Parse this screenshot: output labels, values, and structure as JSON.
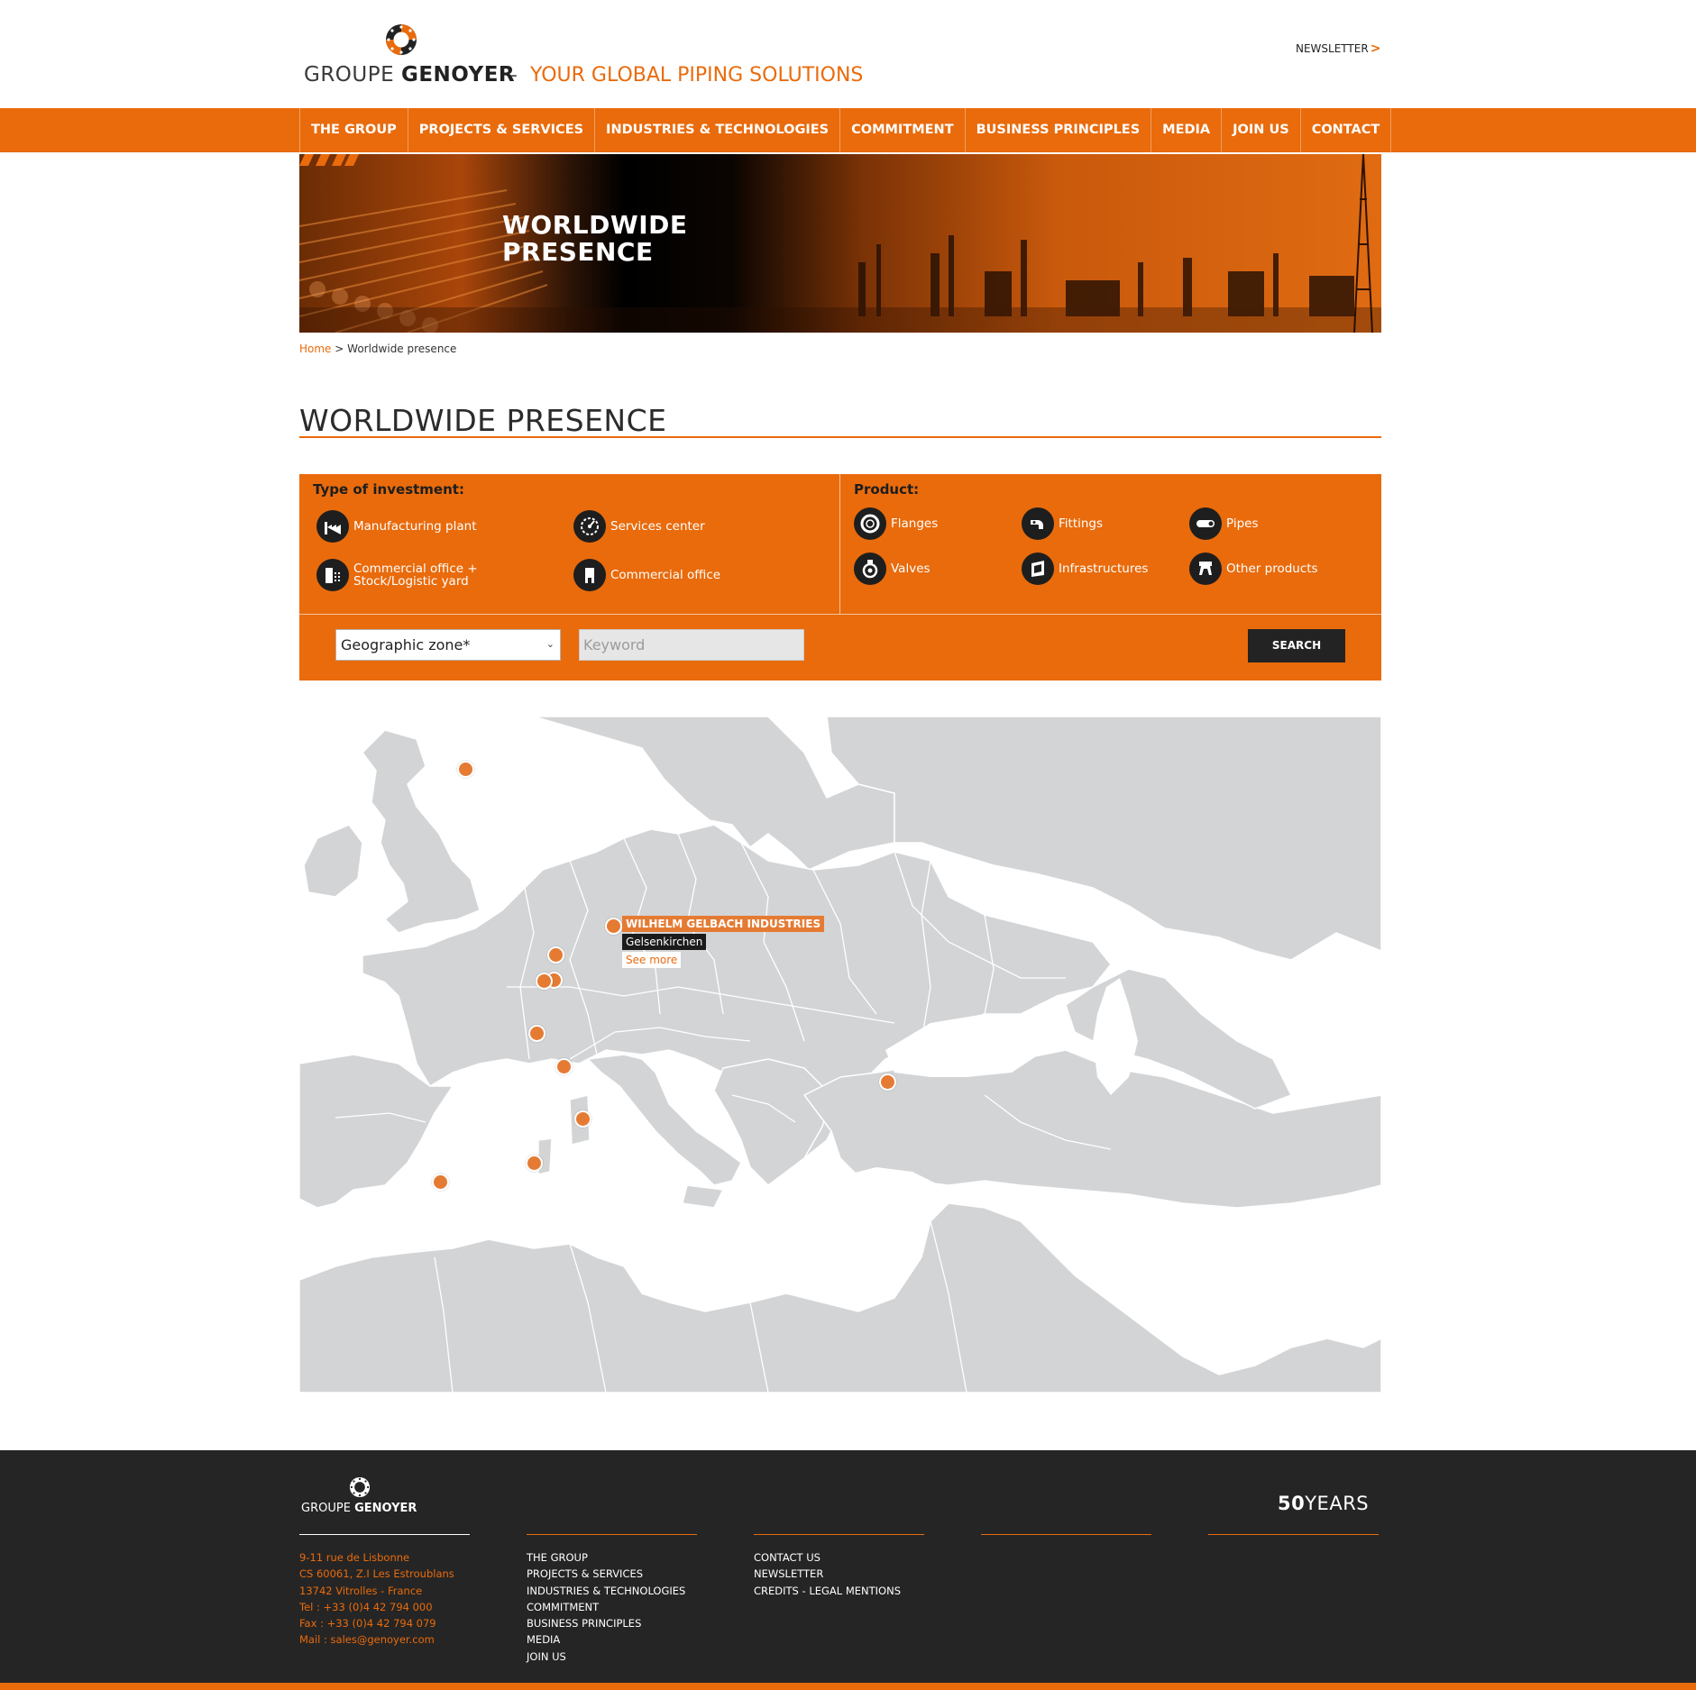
{
  "header": {
    "logo_prefix": "GROUPE",
    "logo_bold": "GENOYER",
    "separator": "-",
    "tagline": "YOUR GLOBAL PIPING SOLUTIONS",
    "newsletter": "NEWSLETTER",
    "newsletter_chevron": ">"
  },
  "nav": {
    "items": [
      {
        "label": "THE GROUP"
      },
      {
        "label": "PROJECTS & SERVICES"
      },
      {
        "label": "INDUSTRIES & TECHNOLOGIES"
      },
      {
        "label": "COMMITMENT"
      },
      {
        "label": "BUSINESS PRINCIPLES"
      },
      {
        "label": "MEDIA"
      },
      {
        "label": "JOIN US"
      },
      {
        "label": "CONTACT"
      }
    ]
  },
  "banner": {
    "title_line1": "WORLDWIDE",
    "title_line2": "PRESENCE"
  },
  "breadcrumb": {
    "home": "Home",
    "separator": ">",
    "current": "Worldwide presence"
  },
  "page_title": "WORLDWIDE PRESENCE",
  "filters": {
    "investment_heading": "Type of investment:",
    "investment_types": [
      {
        "label": "Manufacturing plant",
        "icon": "factory-icon"
      },
      {
        "label": "Services center",
        "icon": "gauge-icon"
      },
      {
        "label": "Commercial office + Stock/Logistic yard",
        "icon": "warehouse-icon"
      },
      {
        "label": "Commercial office",
        "icon": "office-icon"
      }
    ],
    "product_heading": "Product:",
    "products": [
      {
        "label": "Flanges",
        "icon": "flange-icon"
      },
      {
        "label": "Fittings",
        "icon": "fitting-icon"
      },
      {
        "label": "Pipes",
        "icon": "pipe-icon"
      },
      {
        "label": "Valves",
        "icon": "valve-icon"
      },
      {
        "label": "Infrastructures",
        "icon": "infrastructure-icon"
      },
      {
        "label": "Other products",
        "icon": "other-products-icon"
      }
    ],
    "zone_select": "Geographic zone*",
    "keyword_placeholder": "Keyword",
    "search_label": "SEARCH"
  },
  "map": {
    "popup": {
      "company": "WILHELM GELBACH INDUSTRIES",
      "city": "Gelsenkirchen",
      "link": "See more"
    },
    "pin_count": 12
  },
  "footer": {
    "logo_prefix": "GROUPE",
    "logo_bold": "GENOYER",
    "years_number": "50",
    "years_label": "YEARS",
    "address": [
      "9-11 rue de Lisbonne",
      "CS 60061, Z.I Les Estroublans",
      "13742 Vitrolles - France",
      "Tel : +33 (0)4 42 794 000",
      "Fax : +33 (0)4 42 794 079",
      "Mail : sales@genoyer.com"
    ],
    "nav_links": [
      "THE GROUP",
      "PROJECTS & SERVICES",
      "INDUSTRIES & TECHNOLOGIES",
      "COMMITMENT",
      "BUSINESS PRINCIPLES",
      "MEDIA",
      "JOIN US"
    ],
    "misc_links": [
      "CONTACT US",
      "NEWSLETTER",
      "CREDITS - LEGAL MENTIONS"
    ]
  },
  "colors": {
    "brand_orange": "#e96b0c",
    "pin_orange": "#e57b33",
    "dark": "#252525",
    "land_gray": "#d3d4d6"
  }
}
